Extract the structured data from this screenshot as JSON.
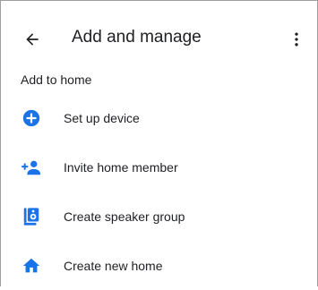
{
  "header": {
    "title": "Add and manage",
    "back_icon": "arrow-back-icon",
    "menu_icon": "more-vert-icon"
  },
  "section": {
    "label": "Add to home"
  },
  "items": [
    {
      "label": "Set up device",
      "icon": "add-circle-icon"
    },
    {
      "label": "Invite home member",
      "icon": "person-add-icon"
    },
    {
      "label": "Create speaker group",
      "icon": "speaker-group-icon"
    },
    {
      "label": "Create new home",
      "icon": "home-icon"
    }
  ],
  "colors": {
    "accent": "#1a73e8",
    "text": "#202124"
  }
}
